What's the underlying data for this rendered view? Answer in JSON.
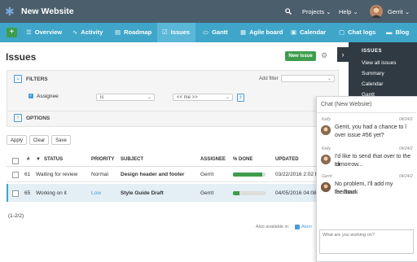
{
  "topbar": {
    "title": "New Website",
    "projects_label": "Projects",
    "help_label": "Help",
    "user_name": "Gerrit",
    "search_icon": "search-icon"
  },
  "menu": {
    "plus_label": "+",
    "items": [
      {
        "label": "Overview",
        "icon": "☰"
      },
      {
        "label": "Activity",
        "icon": "∿"
      },
      {
        "label": "Roadmap",
        "icon": "▤"
      },
      {
        "label": "Issues",
        "icon": "☑"
      },
      {
        "label": "Gantt",
        "icon": "▭"
      },
      {
        "label": "Agile board",
        "icon": "▦"
      },
      {
        "label": "Calendar",
        "icon": "▣"
      },
      {
        "label": "Chat logs",
        "icon": "▢"
      },
      {
        "label": "Blog",
        "icon": "▬"
      }
    ]
  },
  "page": {
    "title": "Issues",
    "new_issue_label": "New issue"
  },
  "filters": {
    "label": "FILTERS",
    "add_filter_label": "Add filter",
    "assignee_label": "Assignee",
    "operator_value": "is",
    "value_select": "<< me >>"
  },
  "options": {
    "label": "OPTIONS"
  },
  "actions": {
    "apply": "Apply",
    "clear": "Clear",
    "save": "Save"
  },
  "table": {
    "headers": {
      "num": "#",
      "status": "STATUS",
      "priority": "PRIORITY",
      "subject": "SUBJECT",
      "assignee": "ASSIGNEE",
      "done": "% DONE",
      "updated": "UPDATED"
    },
    "sort_indicator": "▼",
    "rows": [
      {
        "id": "61",
        "status": "Waiting for review",
        "priority": "Normal",
        "subject": "Design header and footer",
        "assignee": "Gerrit",
        "done": 90,
        "updated": "03/22/2016 2:02 PM"
      },
      {
        "id": "65",
        "status": "Working on it",
        "priority": "Low",
        "subject": "Style Guide Draft",
        "assignee": "Gerrit",
        "done": 20,
        "updated": "04/05/2016 04:08 PM"
      }
    ],
    "pagination": "(1-2/2)",
    "also_available": "Also available in:",
    "atom_label": "Atom"
  },
  "sidebar": {
    "heading": "ISSUES",
    "items": [
      "View all issues",
      "Summary",
      "Calendar",
      "Gantt"
    ]
  },
  "chat": {
    "title": "Chat (New Website)",
    "messages": [
      {
        "author": "Kelly",
        "time": "04/24/2",
        "line1": "Gerrit, you had a chance to l",
        "line2": "over issue #56 yet?"
      },
      {
        "author": "Kelly",
        "time": "04/24/2",
        "line1": "I'd like to send that over to the cli",
        "line2": "tomorrow..."
      },
      {
        "author": "Gerrit",
        "time": "04/24/2",
        "line1": "No problem, I'll add my feedback",
        "line2": "the hour."
      }
    ],
    "input_placeholder": "What are you working on?"
  },
  "colors": {
    "topbar": "#4b5e6c",
    "menubar": "#3fa6c9",
    "accent_green": "#3d9d4c",
    "sidebar": "#2f3a42",
    "selected_row": "#e3eef5",
    "link": "#4a9cd6"
  }
}
